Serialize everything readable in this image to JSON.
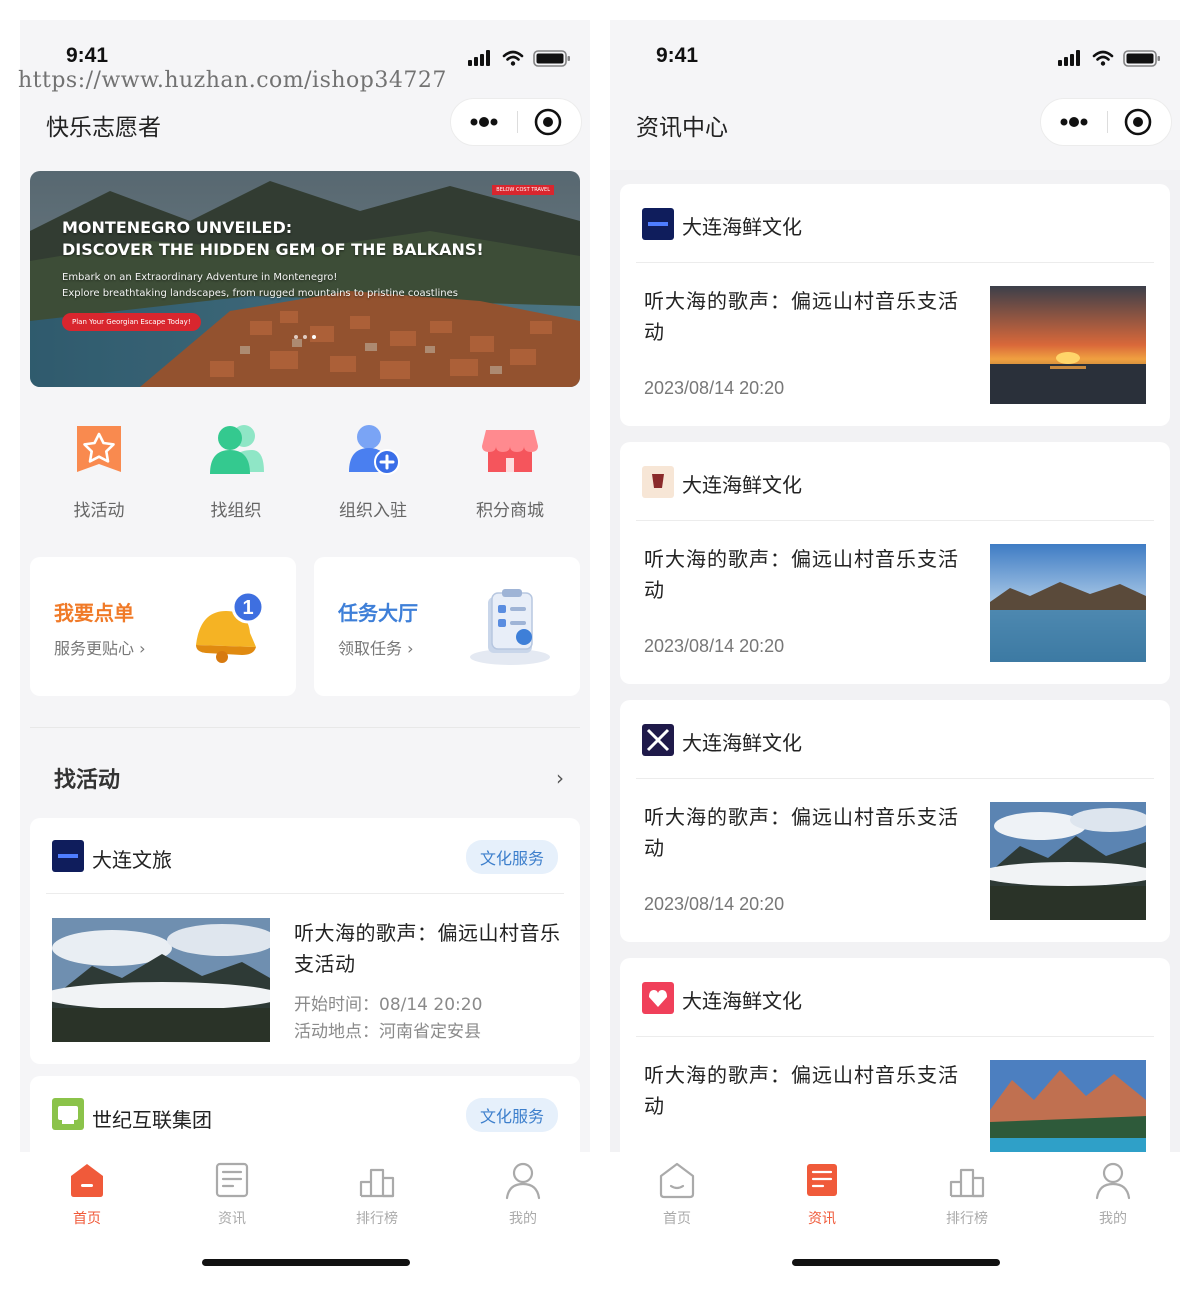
{
  "watermark": "https://www.huzhan.com/ishop34727",
  "left": {
    "status_time": "9:41",
    "nav_title": "快乐志愿者",
    "banner": {
      "headline_1": "MONTENEGRO UNVEILED:",
      "headline_2": "DISCOVER THE HIDDEN GEM OF THE BALKANS!",
      "sub_1": "Embark on an Extraordinary Adventure in Montenegro!",
      "sub_2": "Explore breathtaking landscapes, from rugged mountains to pristine coastlines",
      "cta": "Plan Your Georgian Escape Today!",
      "logo": "BELOW COST TRAVEL"
    },
    "quick_items": [
      {
        "label": "找活动",
        "icon": "star-badge-icon",
        "color": "#f98a4f"
      },
      {
        "label": "找组织",
        "icon": "people-icon",
        "color": "#3ecfa0"
      },
      {
        "label": "组织入驻",
        "icon": "add-user-icon",
        "color": "#4a7ff0"
      },
      {
        "label": "积分商城",
        "icon": "store-icon",
        "color": "#f5555c"
      }
    ],
    "promos": [
      {
        "title": "我要点单",
        "sub": "服务更贴心 ›",
        "color": "#f07a28"
      },
      {
        "title": "任务大厅",
        "sub": "领取任务 ›",
        "color": "#3e7fd8"
      }
    ],
    "section_title": "找活动",
    "section_arrow": "›",
    "activities": [
      {
        "org": "大连文旅",
        "tag": "文化服务",
        "title": "听大海的歌声：偏远山村音乐支活动",
        "start": "开始时间：08/14 20:20",
        "place": "活动地点：河南省定安县"
      },
      {
        "org": "世纪互联集团",
        "tag": "文化服务"
      }
    ],
    "tabs": [
      {
        "label": "首页",
        "active": true
      },
      {
        "label": "资讯",
        "active": false
      },
      {
        "label": "排行榜",
        "active": false
      },
      {
        "label": "我的",
        "active": false
      }
    ]
  },
  "right": {
    "status_time": "9:41",
    "nav_title": "资讯中心",
    "news": [
      {
        "org": "大连海鲜文化",
        "title": "听大海的歌声：偏远山村音乐支活动",
        "date": "2023/08/14 20:20",
        "thumb": "sunset"
      },
      {
        "org": "大连海鲜文化",
        "title": "听大海的歌声：偏远山村音乐支活动",
        "date": "2023/08/14 20:20",
        "thumb": "lake"
      },
      {
        "org": "大连海鲜文化",
        "title": "听大海的歌声：偏远山村音乐支活动",
        "date": "2023/08/14 20:20",
        "thumb": "clouds"
      },
      {
        "org": "大连海鲜文化",
        "title": "听大海的歌声：偏远山村音乐支活动",
        "date": "",
        "thumb": "mountain-lake"
      }
    ],
    "tabs": [
      {
        "label": "首页",
        "active": false
      },
      {
        "label": "资讯",
        "active": true
      },
      {
        "label": "排行榜",
        "active": false
      },
      {
        "label": "我的",
        "active": false
      }
    ]
  },
  "colors": {
    "accent_orange": "#f05a3a",
    "tag_blue": "#3d7fcc",
    "background": "#f5f5f7"
  }
}
